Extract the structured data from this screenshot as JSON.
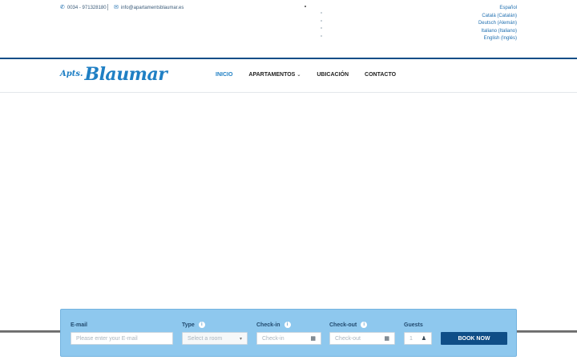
{
  "topbar": {
    "phone": "0034 - 971328180",
    "email": "info@apartamentsblaumar.es",
    "languages": [
      "Español",
      "Català (Catalán)",
      "Deutsch (Alemán)",
      "Italiano (Italiano)",
      "English (Inglés)"
    ]
  },
  "logo": {
    "prefix": "Apts.",
    "name": "Blaumar"
  },
  "menu": {
    "items": [
      {
        "label": "INICIO"
      },
      {
        "label": "APARTAMENTOS"
      },
      {
        "label": "UBICACIÓN"
      },
      {
        "label": "CONTACTO"
      }
    ]
  },
  "booking": {
    "email_label": "E-mail",
    "email_placeholder": "Please enter your E-mail",
    "type_label": "Type",
    "type_placeholder": "Select a room",
    "checkin_label": "Check-in",
    "checkin_placeholder": "Check-in",
    "checkout_label": "Check-out",
    "checkout_placeholder": "Check-out",
    "guests_label": "Guests",
    "guests_value": "1",
    "book_label": "BOOK NOW"
  },
  "colors": {
    "accent": "#1f7fc4",
    "navy": "#0f4e87",
    "booking_bg": "#8ec8ee"
  }
}
